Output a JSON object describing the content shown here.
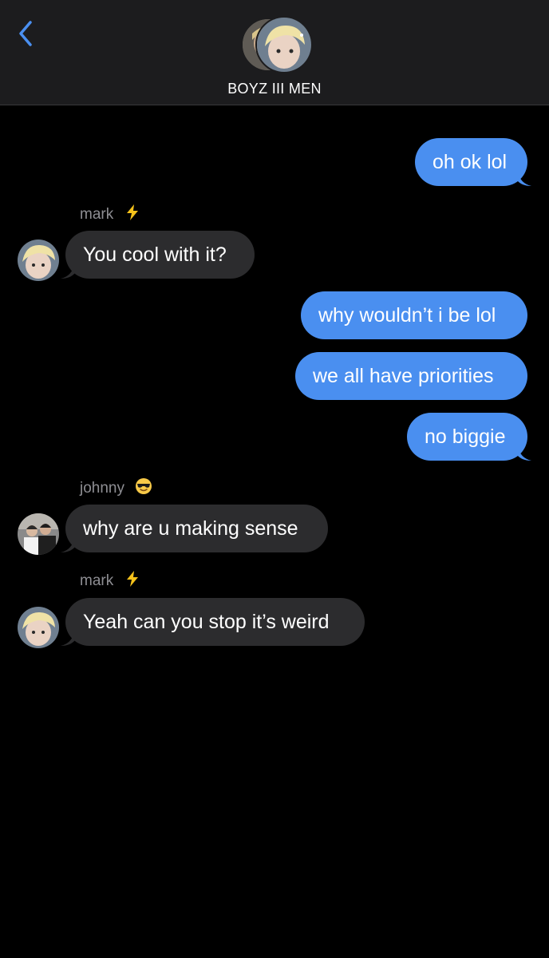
{
  "header": {
    "group_name": "BOYZ III MEN",
    "back_icon": "chevron-left-icon",
    "accent_color": "#4a8ff0"
  },
  "messages": [
    {
      "direction": "outgoing",
      "text": "oh ok lol"
    },
    {
      "direction": "incoming",
      "sender": "mark",
      "sender_emoji": "high-voltage",
      "text": "You cool with it?"
    },
    {
      "direction": "outgoing",
      "text": "why wouldn’t i be lol"
    },
    {
      "direction": "outgoing",
      "text": "we all have priorities"
    },
    {
      "direction": "outgoing",
      "text": "no biggie"
    },
    {
      "direction": "incoming",
      "sender": "johnny",
      "sender_emoji": "smiling-face-with-sunglasses",
      "text": "why are u making sense"
    },
    {
      "direction": "incoming",
      "sender": "mark",
      "sender_emoji": "high-voltage",
      "text": "Yeah can you stop it’s weird"
    }
  ],
  "colors": {
    "outgoing_bubble": "#4a8ff0",
    "incoming_bubble": "#2c2c2e",
    "sender_name": "#8e8e93",
    "header_bg": "#1c1c1e",
    "background": "#000000"
  }
}
